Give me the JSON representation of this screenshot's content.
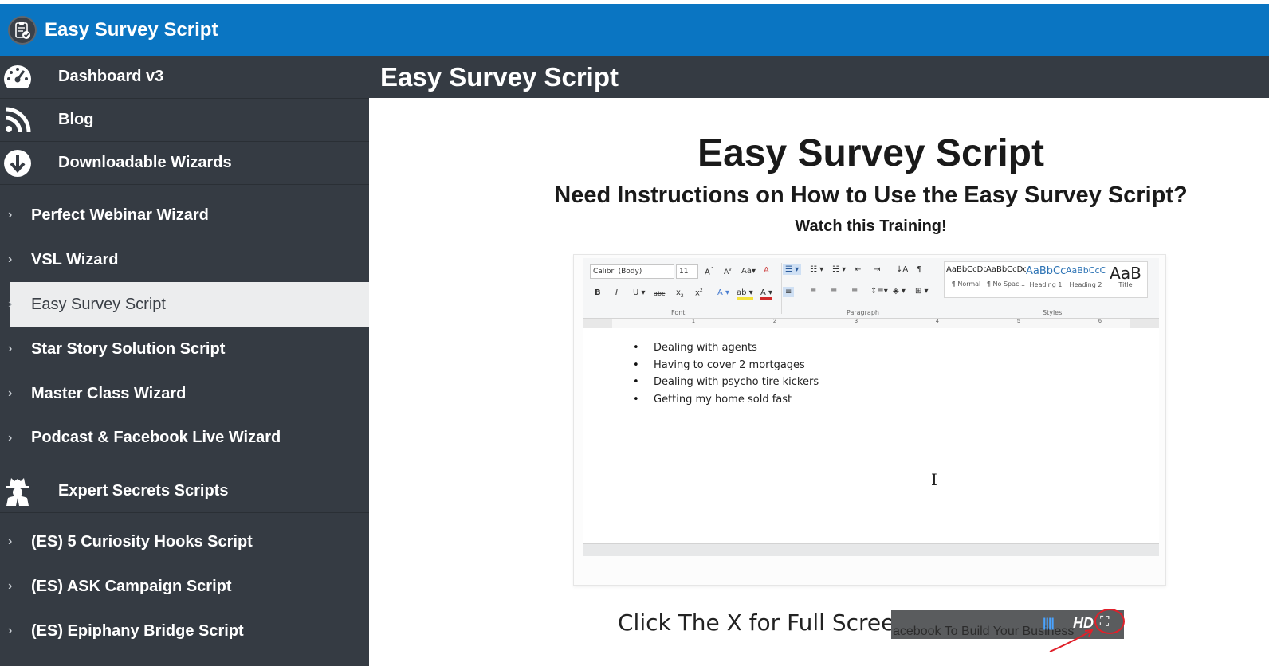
{
  "app": {
    "title": "Easy Survey Script"
  },
  "sidebar": {
    "items": [
      {
        "type": "main",
        "label": "Dashboard v3",
        "icon": "dashboard-gauge-icon"
      },
      {
        "type": "main",
        "label": "Blog",
        "icon": "rss-icon"
      },
      {
        "type": "main",
        "label": "Downloadable Wizards",
        "icon": "download-circle-icon"
      },
      {
        "type": "sub",
        "label": "Perfect Webinar Wizard"
      },
      {
        "type": "sub",
        "label": "VSL Wizard"
      },
      {
        "type": "sub",
        "label": "Easy Survey Script",
        "active": true
      },
      {
        "type": "sub",
        "label": "Star Story Solution Script"
      },
      {
        "type": "sub",
        "label": "Master Class Wizard"
      },
      {
        "type": "sub",
        "label": "Podcast & Facebook Live Wizard"
      },
      {
        "type": "main",
        "label": "Expert Secrets Scripts",
        "icon": "spy-agent-icon"
      },
      {
        "type": "sub",
        "label": "(ES) 5 Curiosity Hooks Script"
      },
      {
        "type": "sub",
        "label": "(ES) ASK Campaign Script"
      },
      {
        "type": "sub",
        "label": "(ES) Epiphany Bridge Script"
      }
    ]
  },
  "page": {
    "header": "Easy Survey Script",
    "title": "Easy Survey Script",
    "subtitle": "Need Instructions on How to Use the Easy Survey Script?",
    "cta": "Watch this Training!"
  },
  "video": {
    "ribbon": {
      "font_name": "Calibri (Body)",
      "font_size": "11",
      "group_font": "Font",
      "group_paragraph": "Paragraph",
      "group_styles": "Styles",
      "styles": [
        {
          "preview": "AaBbCcDc",
          "name": "¶ Normal"
        },
        {
          "preview": "AaBbCcDc",
          "name": "¶ No Spac..."
        },
        {
          "preview": "AaBbCc",
          "name": "Heading 1"
        },
        {
          "preview": "AaBbCcC",
          "name": "Heading 2"
        },
        {
          "preview": "AaB",
          "name": "Title"
        }
      ],
      "ruler_ticks": [
        "1",
        "2",
        "3",
        "4",
        "5",
        "6"
      ]
    },
    "bullets": [
      "Dealing with agents",
      "Having to cover 2 mortgages",
      "Dealing with psycho tire kickers",
      "Getting my home sold fast"
    ]
  },
  "fullscreen_hint": {
    "text": "Click The X for Full Screen",
    "ghost_caption": "acebook To Build Your Business",
    "hd_label": "HD"
  },
  "colors": {
    "topbar": "#0a75c2",
    "sidebar": "#353b43",
    "annotation": "#e0202a"
  }
}
